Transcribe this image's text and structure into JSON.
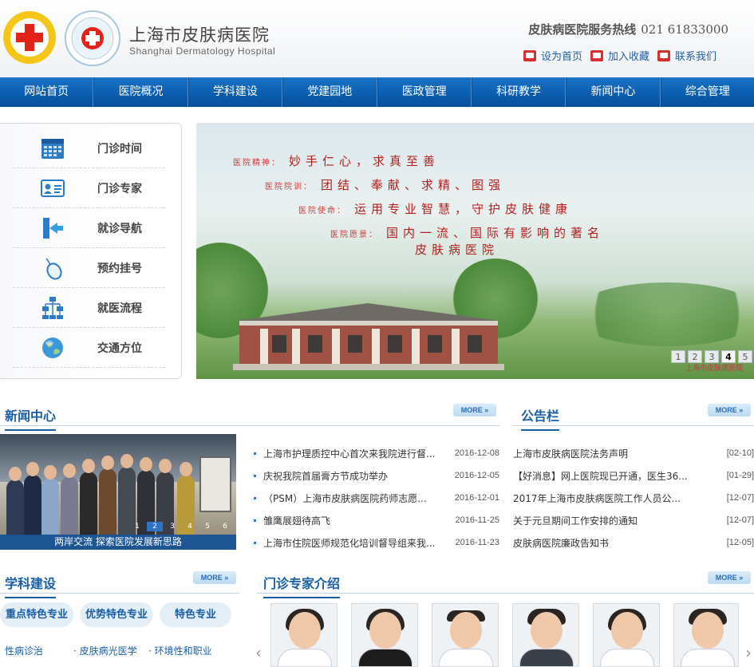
{
  "header": {
    "hospital_name": "上海市皮肤病医院",
    "hospital_name_en": "Shanghai  Dermatology  Hospital",
    "hotline_label": "皮肤病医院服务热线",
    "hotline_number": "021  61833000",
    "links": [
      "设为首页",
      "加入收藏",
      "联系我们"
    ]
  },
  "nav": [
    "网站首页",
    "医院概况",
    "学科建设",
    "党建园地",
    "医政管理",
    "科研教学",
    "新闻中心",
    "综合管理"
  ],
  "quick_links": [
    {
      "label": "门诊时间",
      "icon": "calendar-icon"
    },
    {
      "label": "门诊专家",
      "icon": "id-card-icon"
    },
    {
      "label": "就诊导航",
      "icon": "enter-door-icon"
    },
    {
      "label": "预约挂号",
      "icon": "mouse-icon"
    },
    {
      "label": "就医流程",
      "icon": "org-chart-icon"
    },
    {
      "label": "交通方位",
      "icon": "globe-icon"
    }
  ],
  "banner": {
    "mottos": [
      {
        "label": "医院精神：",
        "text": "妙手仁心，求真至善"
      },
      {
        "label": "医院院训：",
        "text": "团结、奉献、求精、图强"
      },
      {
        "label": "医院使命：",
        "text": "运用专业智慧，守护皮肤健康"
      },
      {
        "label": "医院愿景：",
        "text": "国内一流、国际有影响的著名"
      }
    ],
    "motto_last_line": "皮肤病医院",
    "credit": "上海市皮肤病医院",
    "slides": [
      "1",
      "2",
      "3",
      "4",
      "5"
    ],
    "active_slide": "4"
  },
  "news": {
    "title": "新闻中心",
    "more": "MORE",
    "photo_caption": "两岸交流  探索医院发展新思路",
    "photo_slides": [
      "1",
      "2",
      "3",
      "4",
      "5",
      "6"
    ],
    "items": [
      {
        "title": "上海市护理质控中心首次来我院进行督...",
        "date": "2016-12-08"
      },
      {
        "title": "庆祝我院首届膏方节成功举办",
        "date": "2016-12-05"
      },
      {
        "title": "（PSM）上海市皮肤病医院药师志愿...",
        "date": "2016-12-01"
      },
      {
        "title": "雏鹰展翅待高飞",
        "date": "2016-11-25"
      },
      {
        "title": "上海市住院医师规范化培训督导组来我...",
        "date": "2016-11-23"
      }
    ]
  },
  "notices": {
    "title": "公告栏",
    "more": "MORE",
    "items": [
      {
        "title": "上海市皮肤病医院法务声明",
        "date": "[02-10]"
      },
      {
        "title": "【好消息】网上医院现已开通，医生36...",
        "date": "[01-29]"
      },
      {
        "title": "2017年上海市皮肤病医院工作人员公...",
        "date": "[12-07]"
      },
      {
        "title": "关于元旦期间工作安排的通知",
        "date": "[12-07]"
      },
      {
        "title": "皮肤病医院廉政告知书",
        "date": "[12-05]"
      }
    ]
  },
  "discipline": {
    "title": "学科建设",
    "more": "MORE",
    "tags": [
      "重点特色专业",
      "优势特色专业",
      "特色专业"
    ],
    "links": [
      "性病诊治",
      "皮肤病光医学",
      "环境性和职业"
    ]
  },
  "experts": {
    "title": "门诊专家介绍",
    "more": "MORE"
  }
}
